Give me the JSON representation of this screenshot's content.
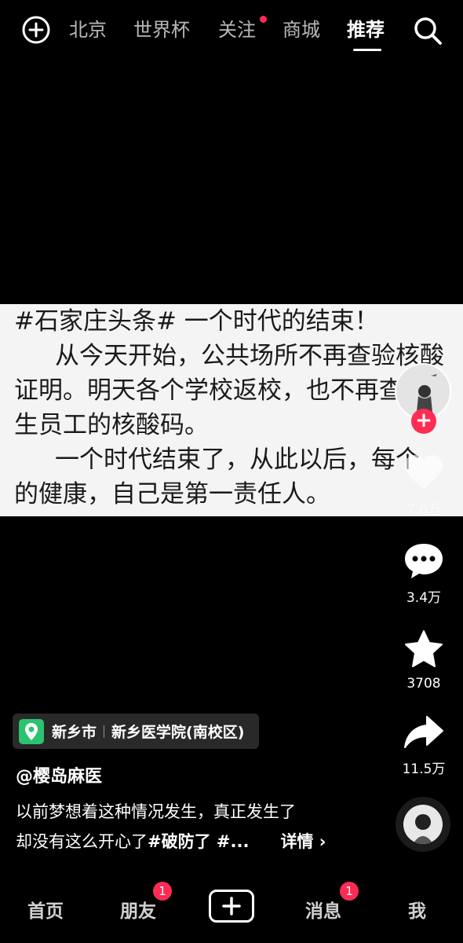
{
  "top_nav": {
    "tabs": [
      "北京",
      "世界杯",
      "关注",
      "商城",
      "推荐"
    ],
    "active_tab": "推荐",
    "follow_has_dot": true
  },
  "video": {
    "lines": [
      "#石家庄头条# 一个时代的结束！",
      "从今天开始，公共场所不再查验核酸",
      "证明。明天各个学校返校，也不再查",
      "生员工的核酸码。",
      "一个时代结束了，从此以后，每个",
      "的健康，自己是第一责任人。"
    ]
  },
  "actions": {
    "likes": "7.0万",
    "comments": "3.4万",
    "favorites": "3708",
    "shares": "11.5万"
  },
  "location": {
    "city": "新乡市",
    "place": "新乡医学院(南校区)"
  },
  "author": "@樱岛麻医",
  "caption": {
    "line1": "以前梦想着这种情况发生，真正发生了",
    "line2_text": "却没有这么开心了",
    "line2_tag": "#破防了 #...",
    "more": "详情"
  },
  "bottom_nav": {
    "home": "首页",
    "friends": "朋友",
    "friends_badge": "1",
    "messages": "消息",
    "messages_badge": "1",
    "me": "我"
  },
  "colors": {
    "accent": "#fe2c55",
    "location_green": "#2bc36f",
    "background": "#000000"
  }
}
